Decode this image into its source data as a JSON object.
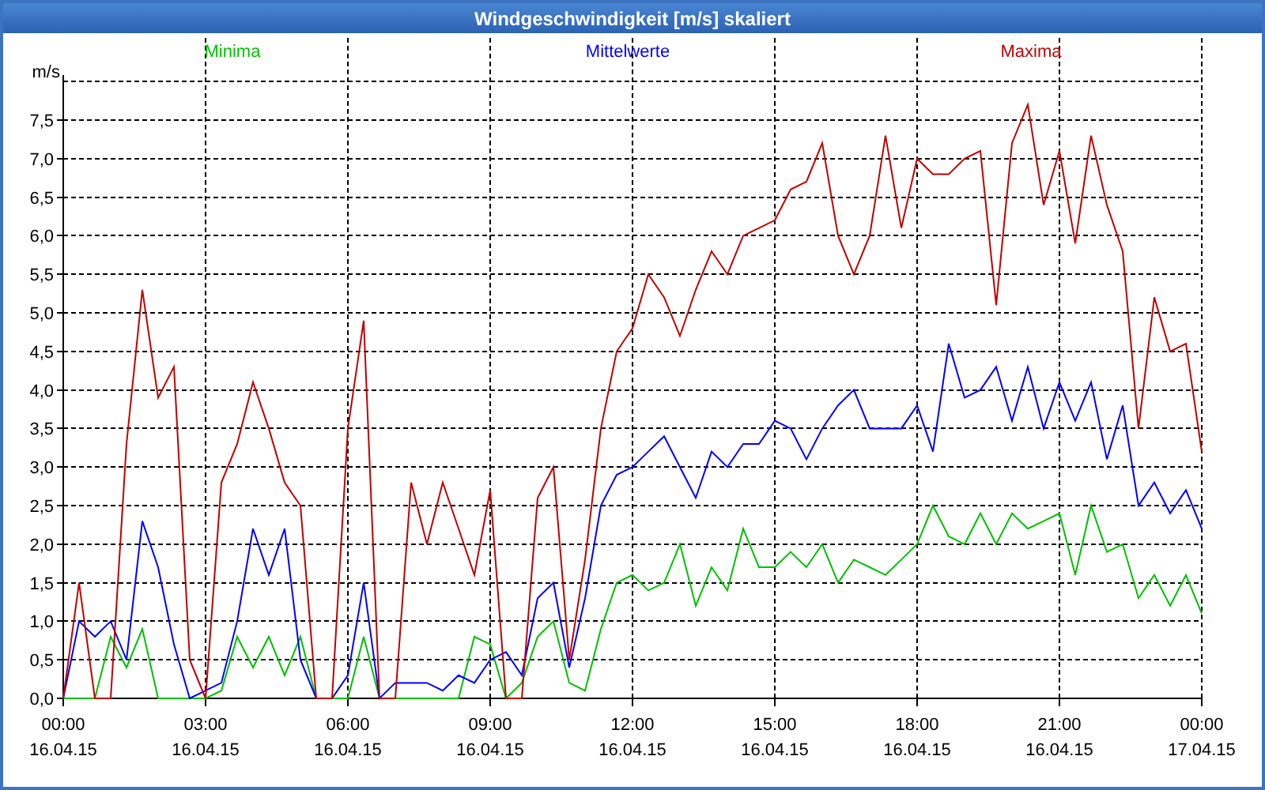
{
  "window": {
    "title": "Windgeschwindigkeit [m/s] skaliert"
  },
  "chart": {
    "chart_data": {
      "type": "line",
      "ylabel": "m/s",
      "grid": true,
      "ylim": [
        0,
        8
      ],
      "yticks": [
        {
          "value": 0,
          "label": "0,0"
        },
        {
          "value": 0.5,
          "label": "0,5"
        },
        {
          "value": 1,
          "label": "1,0"
        },
        {
          "value": 1.5,
          "label": "1,5"
        },
        {
          "value": 2,
          "label": "2,0"
        },
        {
          "value": 2.5,
          "label": "2,5"
        },
        {
          "value": 3,
          "label": "3,0"
        },
        {
          "value": 3.5,
          "label": "3,5"
        },
        {
          "value": 4,
          "label": "4,0"
        },
        {
          "value": 4.5,
          "label": "4,5"
        },
        {
          "value": 5,
          "label": "5,0"
        },
        {
          "value": 5.5,
          "label": "5,5"
        },
        {
          "value": 6,
          "label": "6,0"
        },
        {
          "value": 6.5,
          "label": "6,5"
        },
        {
          "value": 7,
          "label": "7,0"
        },
        {
          "value": 7.5,
          "label": "7,5"
        }
      ],
      "categories": [
        "00:00\n16.04.15",
        null,
        null,
        null,
        null,
        null,
        null,
        null,
        null,
        "03:00\n16.04.15",
        null,
        null,
        null,
        null,
        null,
        null,
        null,
        null,
        "06:00\n16.04.15",
        null,
        null,
        null,
        null,
        null,
        null,
        null,
        null,
        "09:00\n16.04.15",
        null,
        null,
        null,
        null,
        null,
        null,
        null,
        null,
        "12:00\n16.04.15",
        null,
        null,
        null,
        null,
        null,
        null,
        null,
        null,
        "15:00\n16.04.15",
        null,
        null,
        null,
        null,
        null,
        null,
        null,
        null,
        "18:00\n16.04.15",
        null,
        null,
        null,
        null,
        null,
        null,
        null,
        null,
        "21:00\n16.04.15",
        null,
        null,
        null,
        null,
        null,
        null,
        null,
        null,
        "00:00\n17.04.15"
      ],
      "series": [
        {
          "name": "Minima",
          "color": "#00c000",
          "values": [
            0,
            0,
            0,
            0.8,
            0.4,
            0.9,
            0,
            0,
            0,
            0,
            0.1,
            0.8,
            0.4,
            0.8,
            0.3,
            0.8,
            0,
            0,
            0,
            0.8,
            0,
            0,
            0,
            0,
            0,
            0,
            0.8,
            0.7,
            0,
            0.2,
            0.8,
            1.0,
            0.2,
            0.1,
            0.9,
            1.5,
            1.6,
            1.4,
            1.5,
            2.0,
            1.2,
            1.7,
            1.4,
            2.2,
            1.7,
            1.7,
            1.9,
            1.7,
            2.0,
            1.5,
            1.8,
            1.7,
            1.6,
            1.8,
            2.0,
            2.5,
            2.1,
            2.0,
            2.4,
            2.0,
            2.4,
            2.2,
            2.3,
            2.4,
            1.6,
            2.5,
            1.9,
            2.0,
            1.3,
            1.6,
            1.2,
            1.6,
            1.1
          ]
        },
        {
          "name": "Mittelwerte",
          "color": "#0000ff",
          "values": [
            0,
            1.0,
            0.8,
            1.0,
            0.5,
            2.3,
            1.7,
            0.7,
            0,
            0.1,
            0.2,
            1.0,
            2.2,
            1.6,
            2.2,
            0.5,
            0,
            0,
            0.3,
            1.5,
            0,
            0.2,
            0.2,
            0.2,
            0.1,
            0.3,
            0.2,
            0.5,
            0.6,
            0.3,
            1.3,
            1.5,
            0.4,
            1.3,
            2.5,
            2.9,
            3.0,
            3.2,
            3.4,
            3.0,
            2.6,
            3.2,
            3.0,
            3.3,
            3.3,
            3.6,
            3.5,
            3.1,
            3.5,
            3.8,
            4.0,
            3.5,
            3.5,
            3.5,
            3.8,
            3.2,
            4.6,
            3.9,
            4.0,
            4.3,
            3.6,
            4.3,
            3.5,
            4.1,
            3.6,
            4.1,
            3.1,
            3.8,
            2.5,
            2.8,
            2.4,
            2.7,
            2.2
          ]
        },
        {
          "name": "Maxima",
          "color": "#c00000",
          "values": [
            0,
            1.5,
            0,
            0,
            3.3,
            5.3,
            3.9,
            4.3,
            0.5,
            0,
            2.8,
            3.3,
            4.1,
            3.5,
            2.8,
            2.5,
            0,
            0,
            3.5,
            4.9,
            0,
            0,
            2.8,
            2.0,
            2.8,
            2.2,
            1.6,
            2.7,
            0,
            0,
            2.6,
            3.0,
            0.5,
            1.8,
            3.5,
            4.5,
            4.8,
            5.5,
            5.2,
            4.7,
            5.3,
            5.8,
            5.5,
            6.0,
            6.1,
            6.2,
            6.6,
            6.7,
            7.2,
            6.0,
            5.5,
            6.0,
            7.3,
            6.1,
            7.0,
            6.8,
            6.8,
            7.0,
            7.1,
            5.1,
            7.2,
            7.7,
            6.4,
            7.1,
            5.9,
            7.3,
            6.4,
            5.8,
            3.5,
            5.2,
            4.5,
            4.6,
            3.2
          ]
        }
      ]
    }
  }
}
